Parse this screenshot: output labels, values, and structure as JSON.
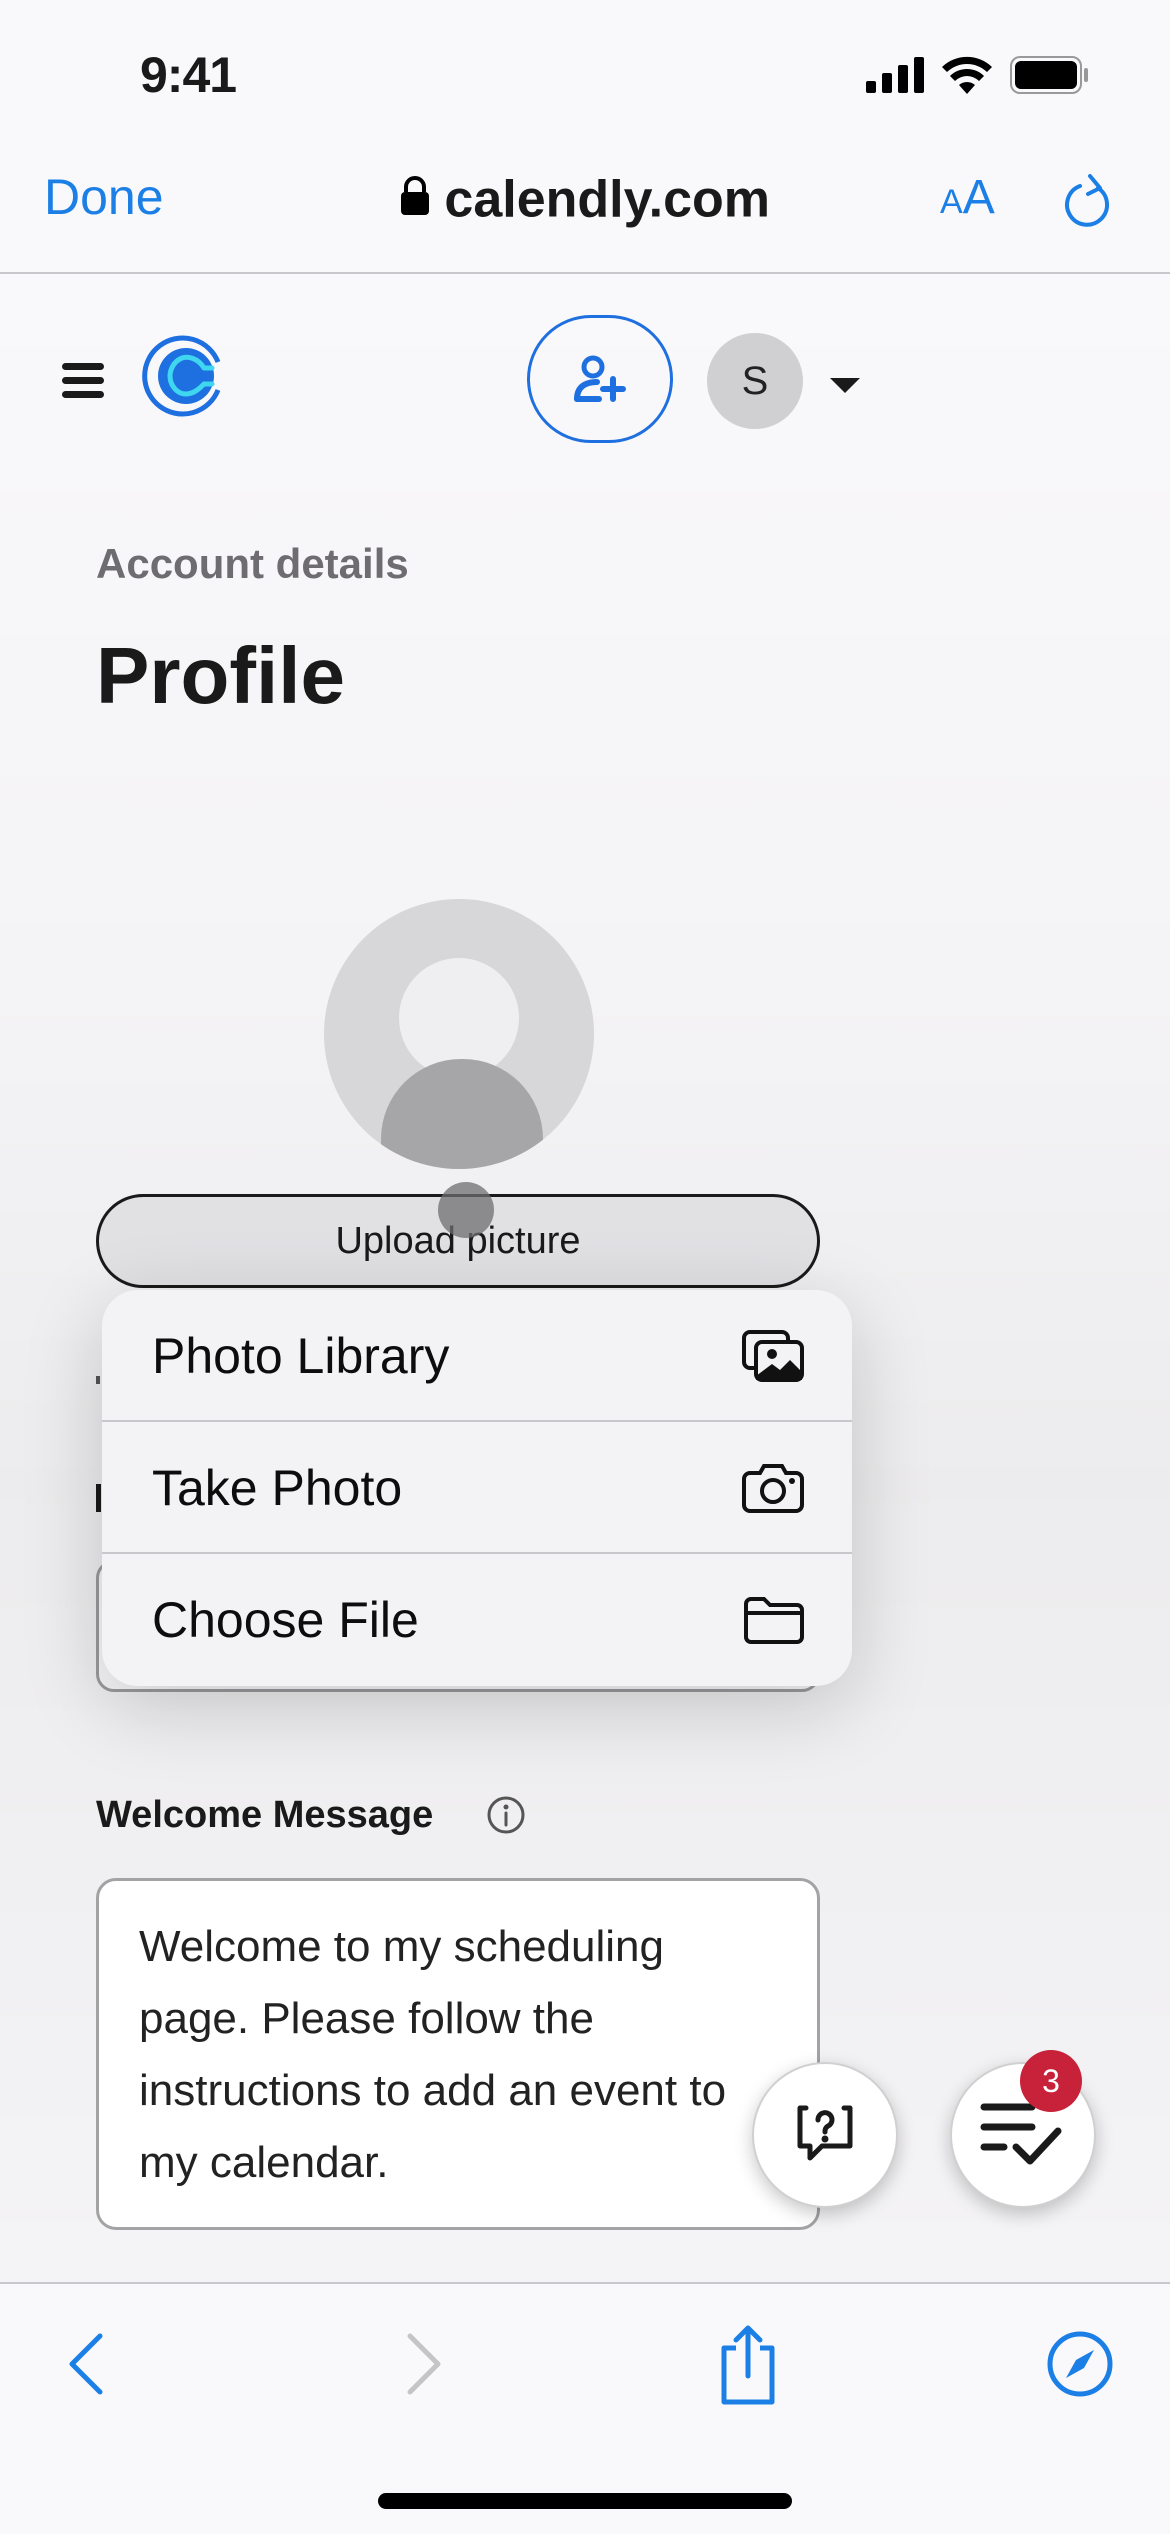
{
  "status_bar": {
    "time": "9:41",
    "icons": [
      "cellular-signal-icon",
      "wifi-icon",
      "battery-icon"
    ]
  },
  "browser": {
    "done_label": "Done",
    "url": "calendly.com",
    "text_size_label_small": "A",
    "text_size_label_large": "A",
    "icons": [
      "lock-icon",
      "reload-icon"
    ],
    "toolbar": [
      "back-icon",
      "forward-icon",
      "share-icon",
      "compass-icon"
    ],
    "accent_color": "#1b7fe6"
  },
  "header": {
    "avatar_initial": "S",
    "brand_color": "#1e6fe0"
  },
  "page": {
    "section_label": "Account details",
    "title": "Profile",
    "upload_button": "Upload picture"
  },
  "context_menu": {
    "items": [
      {
        "label": "Photo Library",
        "icon": "photo-library-icon"
      },
      {
        "label": "Take Photo",
        "icon": "camera-icon"
      },
      {
        "label": "Choose File",
        "icon": "folder-icon"
      }
    ]
  },
  "welcome_message": {
    "label": "Welcome Message",
    "value": "Welcome to my scheduling page. Please follow the instructions to add an event to my calendar."
  },
  "floating_actions": {
    "tasks_badge_count": "3",
    "badge_color": "#c8213a"
  }
}
